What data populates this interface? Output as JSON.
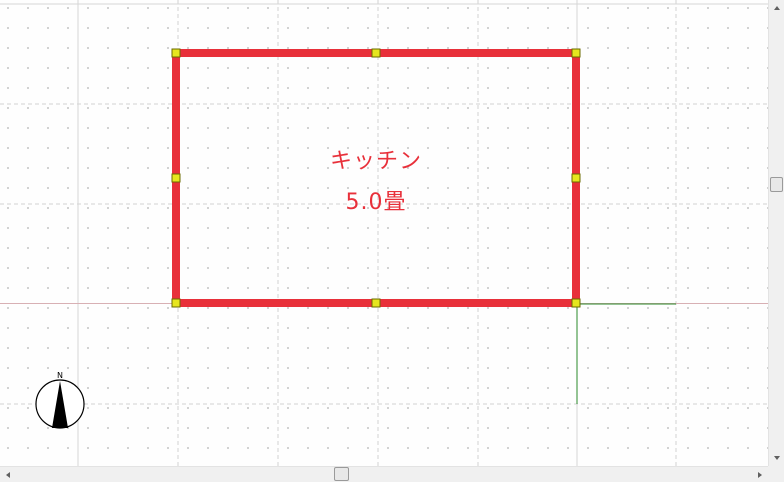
{
  "room": {
    "name": "キッチン",
    "area": "5.0畳",
    "outline_color": "#e8303a",
    "label_color": "#e8303a",
    "handle_color": "#e6e61e"
  },
  "compass": {
    "north_label": "N",
    "icon": "north-arrow-icon"
  },
  "grid": {
    "line_color": "#d2d2d2",
    "dot_color": "#c9c9c9",
    "axis_color": "#d8b0b4",
    "guide_color": "#2a8a2a"
  },
  "scrollbars": {
    "vertical_position": 0.4,
    "horizontal_position": 0.45
  }
}
